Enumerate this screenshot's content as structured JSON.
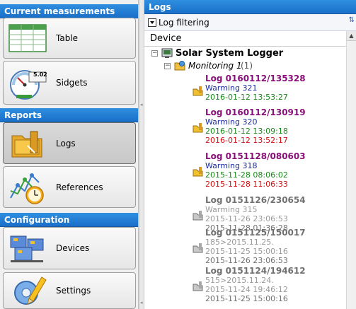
{
  "sidebar": {
    "sections": [
      {
        "title": "Current measurements"
      },
      {
        "title": "Reports"
      },
      {
        "title": "Configuration"
      }
    ],
    "buttons": [
      {
        "label": "Table",
        "icon": "table-icon"
      },
      {
        "label": "Sidgets",
        "icon": "gauge-icon",
        "badge": "5.02"
      },
      {
        "label": "Logs",
        "icon": "logs-folder-icon",
        "selected": true
      },
      {
        "label": "References",
        "icon": "references-chart-icon"
      },
      {
        "label": "Devices",
        "icon": "devices-icon"
      },
      {
        "label": "Settings",
        "icon": "settings-pencil-icon"
      }
    ]
  },
  "main": {
    "title": "Logs",
    "filter_label": "Log filtering",
    "column_header": "Device",
    "device_name": "Solar System Logger",
    "monitoring_label": "Monitoring 1",
    "monitoring_count": "(1)",
    "logs": [
      {
        "title": "Log 0160112/135328",
        "note": "Warming 321",
        "start": "2016-01-12 13:53:27",
        "end": ""
      },
      {
        "title": "Log 0160112/130919",
        "note": "Warming 320",
        "start": "2016-01-12 13:09:18",
        "end": "2016-01-12 13:52:17"
      },
      {
        "title": "Log 0151128/080603",
        "note": "Warming 318",
        "start": "2015-11-28 08:06:02",
        "end": "2015-11-28 11:06:33"
      },
      {
        "title": "Log 0151126/230654",
        "note": "Warming 315",
        "start": "2015-11-26 23:06:53",
        "end": "2015-11-28 01:36:28"
      },
      {
        "title": "Log 0151125/150017",
        "note": "185>2015.11.25.",
        "start": "2015-11-25 15:00:16",
        "end": "2015-11-26 23:06:53"
      },
      {
        "title": "Log 0151124/194612",
        "note": "515>2015.11.24.",
        "start": "2015-11-24 19:46:12",
        "end": "2015-11-25 15:00:16"
      }
    ]
  },
  "colors": {
    "header_blue": "#1a6fc8",
    "log_title_active": "#8a0f7a",
    "log_title_inactive": "#707070",
    "start_time": "#1a8a1a",
    "end_time": "#d01010"
  }
}
